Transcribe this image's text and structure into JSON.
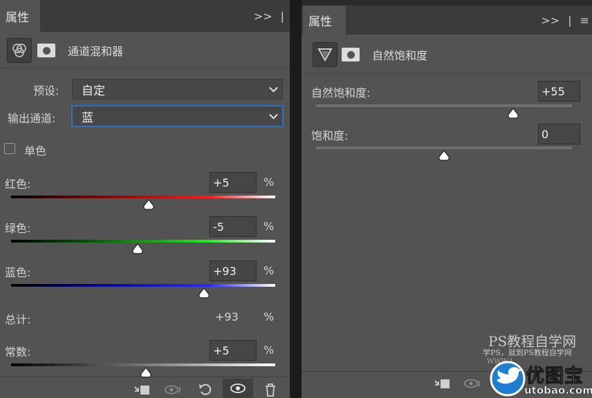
{
  "left_panel": {
    "tab_title": "属性",
    "title": "通道混和器",
    "preset": {
      "label": "预设:",
      "value": "自定"
    },
    "output": {
      "label": "输出通道:",
      "value": "蓝"
    },
    "monochrome_label": "单色",
    "sliders": [
      {
        "label": "红色:",
        "value": "+5",
        "unit": "%",
        "level_pct": 52
      },
      {
        "label": "绿色:",
        "value": "-5",
        "unit": "%",
        "level_pct": 48
      },
      {
        "label": "蓝色:",
        "value": "+93",
        "unit": "%",
        "level_pct": 73
      }
    ],
    "total": {
      "label": "总计:",
      "value": "+93",
      "unit": "%"
    },
    "constant": {
      "label": "常数:",
      "value": "+5",
      "unit": "%",
      "level_pct": 51
    }
  },
  "right_panel": {
    "tab_title": "属性",
    "title": "自然饱和度",
    "vibrance": {
      "label": "自然饱和度:",
      "value": "+55",
      "level_pct": 77
    },
    "saturation": {
      "label": "饱和度:",
      "value": "0",
      "level_pct": 50
    }
  },
  "watermark": {
    "line1": "PS教程自学网",
    "line2": "学PS，就到PS教程自学网",
    "line3": "WWW.1",
    "brand": "优图宝",
    "domain": "utobao.com"
  },
  "colors": {
    "panel": "#535353",
    "focus": "#2b73c4",
    "brand_blue": "#1e7fd1"
  }
}
